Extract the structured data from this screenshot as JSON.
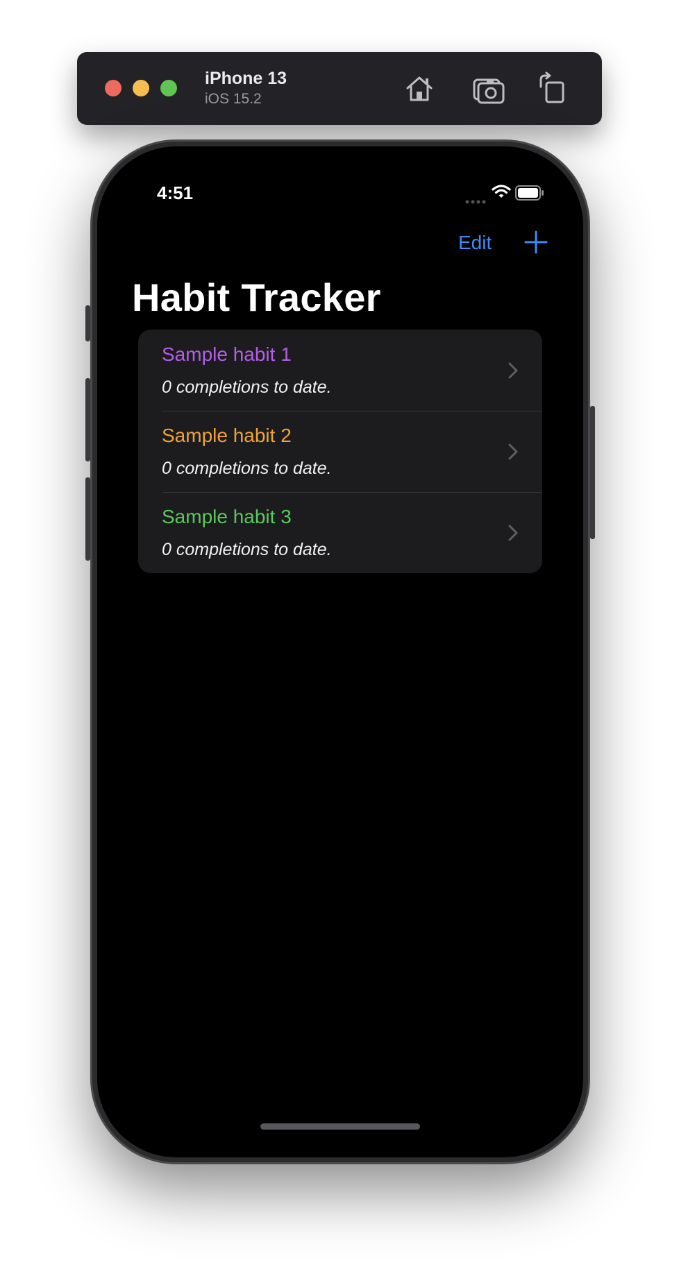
{
  "simulator": {
    "device_name": "iPhone 13",
    "os_version": "iOS 15.2",
    "buttons": {
      "home": "home-icon",
      "screenshot": "camera-icon",
      "rotate": "rotate-icon"
    }
  },
  "status_bar": {
    "time": "4:51"
  },
  "nav_bar": {
    "edit_label": "Edit",
    "add_icon": "plus-icon",
    "accent": "#3b8bfa"
  },
  "title": "Habit Tracker",
  "habits": [
    {
      "name": "Sample habit 1",
      "subtitle": "0 completions to date.",
      "color": "#b35fe8"
    },
    {
      "name": "Sample habit 2",
      "subtitle": "0 completions to date.",
      "color": "#f0a33a"
    },
    {
      "name": "Sample habit 3",
      "subtitle": "0 completions to date.",
      "color": "#5ac95c"
    }
  ]
}
